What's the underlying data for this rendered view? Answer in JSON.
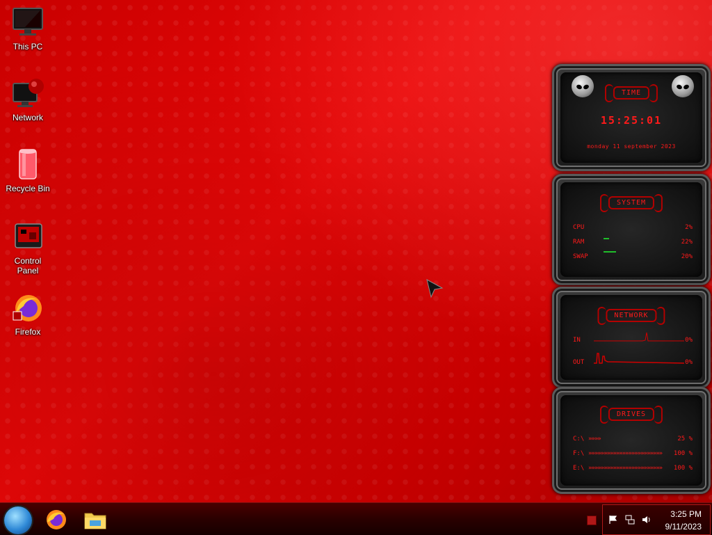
{
  "desktop": {
    "icons": [
      {
        "label": "This PC",
        "icon": "monitor-icon"
      },
      {
        "label": "Network",
        "icon": "network-icon"
      },
      {
        "label": "Recycle Bin",
        "icon": "recycle-bin-icon"
      },
      {
        "label": "Control Panel",
        "icon": "control-panel-icon"
      },
      {
        "label": "Firefox",
        "icon": "firefox-icon"
      }
    ]
  },
  "widgets": {
    "time": {
      "title": "TIME",
      "clock": "15:25:01",
      "date": "monday 11 september 2023"
    },
    "system": {
      "title": "SYSTEM",
      "rows": [
        {
          "label": "CPU",
          "value": "2%",
          "level": 0.02
        },
        {
          "label": "RAM",
          "value": "22%",
          "level": 0.22
        },
        {
          "label": "SWAP",
          "value": "20%",
          "level": 0.2
        }
      ]
    },
    "network": {
      "title": "NETWORK",
      "in_label": "IN",
      "in_value": "0%",
      "out_label": "OUT",
      "out_value": "0%"
    },
    "drives": {
      "title": "DRIVES",
      "rows": [
        {
          "label": "C:\\",
          "value": "25 %",
          "level": 0.25
        },
        {
          "label": "F:\\",
          "value": "100 %",
          "level": 1.0
        },
        {
          "label": "E:\\",
          "value": "100 %",
          "level": 1.0
        }
      ]
    }
  },
  "taskbar": {
    "start_icon": "start-orb-icon",
    "pinned": [
      "firefox-icon",
      "file-explorer-icon"
    ],
    "tray_icons": [
      "flag-icon",
      "network-tray-icon",
      "volume-icon"
    ],
    "time": "3:25 PM",
    "date": "9/11/2023"
  },
  "colors": {
    "accent": "#ff1a1a",
    "background": "#d10000",
    "meter_green": "#1fbf2a"
  }
}
